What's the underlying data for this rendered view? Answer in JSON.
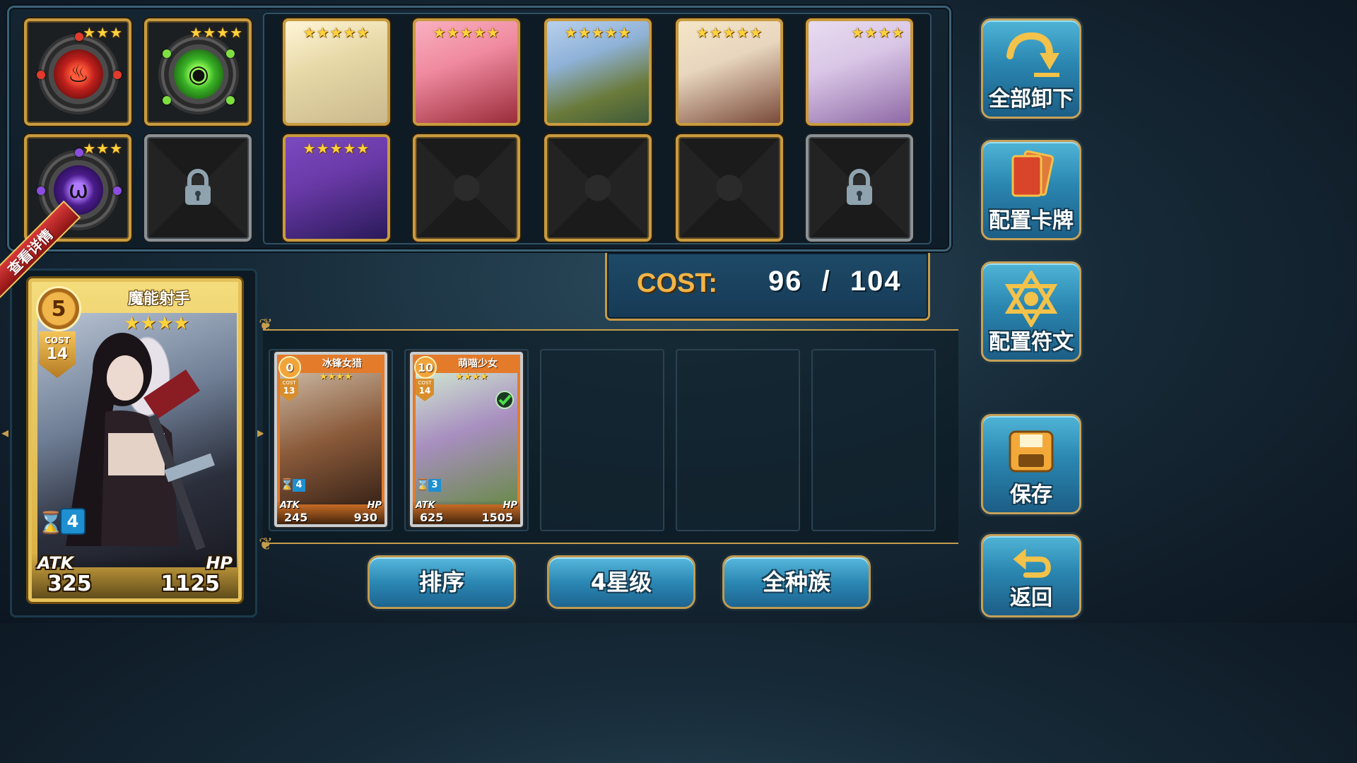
{
  "runes": [
    {
      "stars": "★★★",
      "color": "#c0201c",
      "gem": "#e23b2e",
      "glyph": "♨"
    },
    {
      "stars": "★★★★",
      "color": "#39b226",
      "gem": "#7ee040",
      "glyph": "◉"
    },
    {
      "stars": "★★★",
      "color": "#4a1c8a",
      "gem": "#8a4de0",
      "glyph": "ω"
    }
  ],
  "deck_cards": [
    {
      "stars": "★★★★★",
      "art_top": "#fff6d8",
      "art_bottom": "#c9b98d"
    },
    {
      "stars": "★★★★★",
      "art_top": "#f08aa0",
      "art_bottom": "#9a2c3a"
    },
    {
      "stars": "★★★★★",
      "art_top": "#8fb2d8",
      "art_bottom": "#3f5a3a"
    },
    {
      "stars": "★★★★★",
      "art_top": "#e8d6bf",
      "art_bottom": "#7a4a3a"
    },
    {
      "stars": "★★★★",
      "art_top": "#d9c6e6",
      "art_bottom": "#8f6aa6"
    },
    {
      "stars": "★★★★★",
      "art_top": "#6a3aa8",
      "art_bottom": "#2a1a5a"
    }
  ],
  "cost": {
    "label": "COST:",
    "current": "96",
    "separator": "/",
    "max": "104"
  },
  "side_buttons": {
    "unload_all": "全部卸下",
    "config_cards": "配置卡牌",
    "config_runes": "配置符文",
    "save": "保存",
    "back": "返回"
  },
  "selected_card": {
    "ribbon": "查看详情",
    "level": "5",
    "name": "魔能射手",
    "stars": "★★★★",
    "cost_label": "COST",
    "cost": "14",
    "timer": "4",
    "atk_label": "ATK",
    "atk": "325",
    "hp_label": "HP",
    "hp": "1125"
  },
  "card_list": [
    {
      "level": "0",
      "name": "冰锋女猎",
      "stars": "★★★★",
      "cost_label": "COST",
      "cost": "13",
      "timer": "4",
      "atk_label": "ATK",
      "atk": "245",
      "hp_label": "HP",
      "hp": "930",
      "selected": false
    },
    {
      "level": "10",
      "name": "萌喵少女",
      "stars": "★★★★",
      "cost_label": "COST",
      "cost": "14",
      "timer": "3",
      "atk_label": "ATK",
      "atk": "625",
      "hp_label": "HP",
      "hp": "1505",
      "selected": true
    }
  ],
  "bottom_buttons": {
    "sort": "排序",
    "star_filter": "4星级",
    "race_filter": "全种族"
  },
  "icons": {
    "lock": "lock-icon",
    "checkmark": "check-icon"
  }
}
